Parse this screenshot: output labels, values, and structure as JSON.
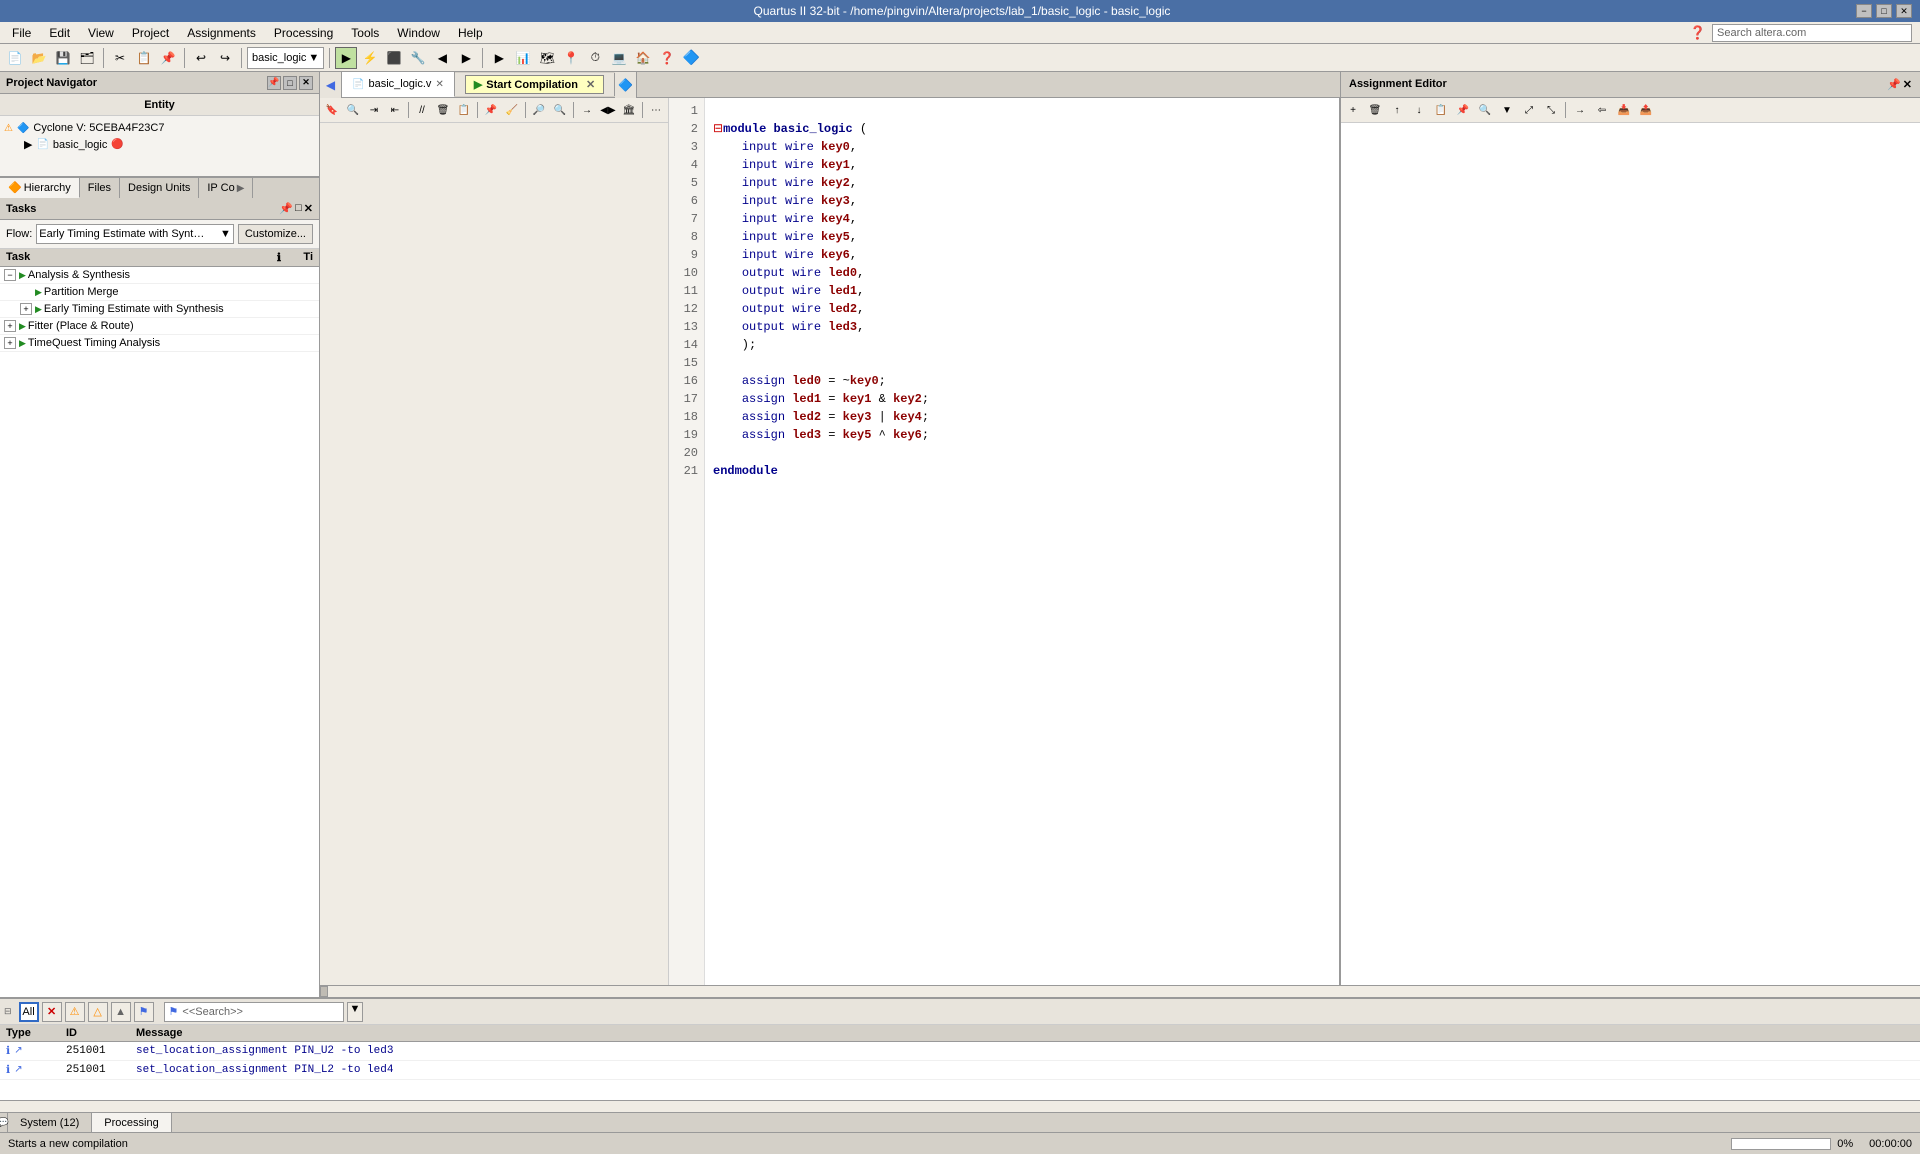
{
  "titlebar": {
    "title": "Quartus II 32-bit - /home/pingvin/Altera/projects/lab_1/basic_logic - basic_logic",
    "minimize": "−",
    "restore": "□",
    "close": "✕"
  },
  "menubar": {
    "items": [
      "File",
      "Edit",
      "View",
      "Project",
      "Assignments",
      "Processing",
      "Tools",
      "Window",
      "Help"
    ]
  },
  "toolbar": {
    "project_dropdown": "basic_logic"
  },
  "project_navigator": {
    "title": "Project Navigator",
    "entity_header": "Entity",
    "chip": "Cyclone V: 5CEBA4F23C7",
    "project": "basic_logic"
  },
  "nav_tabs": {
    "tabs": [
      "Hierarchy",
      "Files",
      "Design Units",
      "IP Co"
    ]
  },
  "tasks": {
    "title": "Tasks",
    "flow_label": "Flow:",
    "flow_value": "Early Timing Estimate with Synthesis",
    "customize_btn": "Customize...",
    "columns": [
      "Task",
      "ℹ",
      "Ti"
    ],
    "items": [
      {
        "label": "Analysis & Synthesis",
        "indent": 1,
        "has_expand": true,
        "expand_open": true
      },
      {
        "label": "Partition Merge",
        "indent": 2,
        "has_expand": false
      },
      {
        "label": "Early Timing Estimate with Synthesis",
        "indent": 2,
        "has_expand": true,
        "expand_open": true
      },
      {
        "label": "Fitter (Place & Route)",
        "indent": 1,
        "has_expand": true,
        "expand_open": false
      },
      {
        "label": "TimeQuest Timing Analysis",
        "indent": 1,
        "has_expand": true,
        "expand_open": false
      }
    ]
  },
  "editor": {
    "tabs": [
      {
        "label": "basic_logic.v",
        "active": true
      },
      {
        "label": "Assignment Editor",
        "active": false
      }
    ],
    "start_compile_btn": "Start Compilation",
    "code": {
      "lines": [
        {
          "num": 1,
          "text": "module basic_logic ("
        },
        {
          "num": 2,
          "text": "    input wire key0,"
        },
        {
          "num": 3,
          "text": "    input wire key1,"
        },
        {
          "num": 4,
          "text": "    input wire key2,"
        },
        {
          "num": 5,
          "text": "    input wire key3,"
        },
        {
          "num": 6,
          "text": "    input wire key4,"
        },
        {
          "num": 7,
          "text": "    input wire key5,"
        },
        {
          "num": 8,
          "text": "    input wire key6,"
        },
        {
          "num": 9,
          "text": "    output wire led0,"
        },
        {
          "num": 10,
          "text": "    output wire led1,"
        },
        {
          "num": 11,
          "text": "    output wire led2,"
        },
        {
          "num": 12,
          "text": "    output wire led3,"
        },
        {
          "num": 13,
          "text": "    );"
        },
        {
          "num": 14,
          "text": ""
        },
        {
          "num": 15,
          "text": "    assign led0 = ~key0;"
        },
        {
          "num": 16,
          "text": "    assign led1 = key1 & key2;"
        },
        {
          "num": 17,
          "text": "    assign led2 = key3 | key4;"
        },
        {
          "num": 18,
          "text": "    assign led3 = key5 ^ key6;"
        },
        {
          "num": 19,
          "text": ""
        },
        {
          "num": 20,
          "text": "endmodule"
        },
        {
          "num": 21,
          "text": ""
        }
      ]
    }
  },
  "assignment_editor": {
    "title": "Assignment Editor"
  },
  "messages": {
    "filter_buttons": [
      "All",
      "✕",
      "⚠",
      "△",
      "▲",
      "⚑"
    ],
    "active_filter": "All",
    "search_placeholder": "<<Search>>",
    "columns": [
      "Type",
      "ID",
      "Message"
    ],
    "rows": [
      {
        "type": "info",
        "id": "251001",
        "text": "set_location_assignment PIN_U2 -to led3"
      },
      {
        "type": "info",
        "id": "251001",
        "text": "set_location_assignment PIN_L2 -to led4"
      }
    ]
  },
  "status": {
    "message": "Starts a new compilation",
    "progress_label": "",
    "progress_pct": 0,
    "time": "00:00:00"
  },
  "bottom_tabs": [
    {
      "label": "System (12)",
      "active": false
    },
    {
      "label": "Processing",
      "active": true
    }
  ]
}
